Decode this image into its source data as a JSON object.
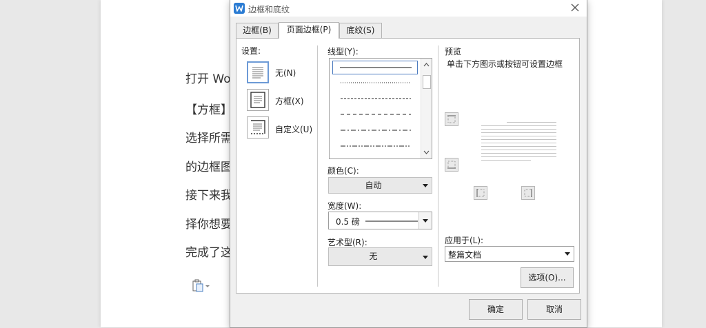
{
  "document": {
    "lines": [
      "打开 Wo",
      "【方框】",
      "选择所需",
      "的边框图",
      "接下来我",
      "择你想要",
      "完成了这"
    ]
  },
  "dialog": {
    "title": "边框和底纹",
    "tabs": [
      {
        "label": "边框(B)"
      },
      {
        "label": "页面边框(P)"
      },
      {
        "label": "底纹(S)"
      }
    ],
    "active_tab": 1,
    "settings": {
      "label": "设置:",
      "options": [
        {
          "label": "无(N)"
        },
        {
          "label": "方框(X)"
        },
        {
          "label": "自定义(U)"
        }
      ],
      "selected": 0
    },
    "line_style": {
      "label": "线型(Y):"
    },
    "color": {
      "label": "颜色(C):",
      "value": "自动"
    },
    "width": {
      "label": "宽度(W):",
      "value": "0.5 磅"
    },
    "art": {
      "label": "艺术型(R):",
      "value": "无"
    },
    "preview": {
      "label": "预览",
      "hint": "单击下方图示或按钮可设置边框"
    },
    "apply_to": {
      "label": "应用于(L):",
      "value": "整篇文档"
    },
    "options_button": "选项(O)...",
    "ok_button": "确定",
    "cancel_button": "取消"
  }
}
